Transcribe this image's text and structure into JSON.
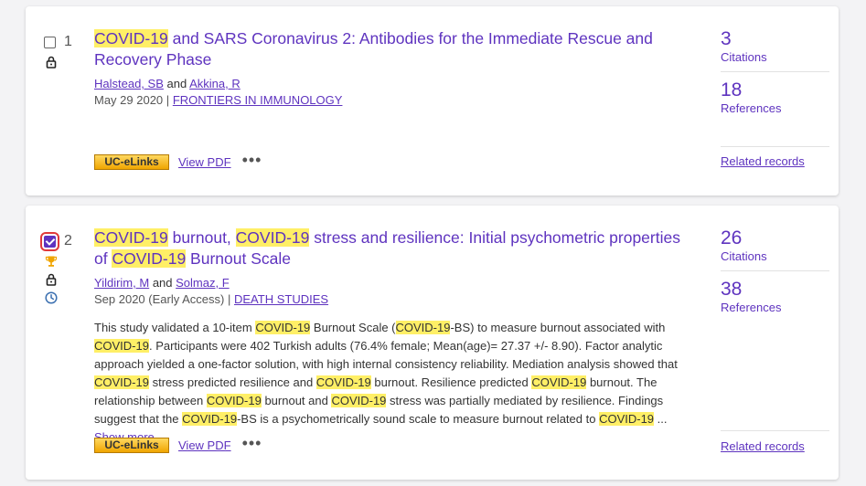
{
  "records": [
    {
      "number": "1",
      "checked": false,
      "title_parts": [
        {
          "text": "COVID-19",
          "hl": true
        },
        {
          "text": " and SARS Coronavirus 2: Antibodies for the Immediate Rescue and Recovery Phase",
          "hl": false
        }
      ],
      "author1": "Halstead, SB",
      "author_and": "and",
      "author2": "Akkina, R",
      "date": "May 29 2020",
      "sep": "|",
      "journal": "FRONTIERS IN IMMUNOLOGY",
      "citations_count": "3",
      "citations_label": "Citations",
      "references_count": "18",
      "references_label": "References",
      "related_label": "Related records",
      "ucelinks_label": "UC-eLinks",
      "viewpdf_label": "View PDF",
      "more_actions_label": "•••"
    },
    {
      "number": "2",
      "checked": true,
      "title_parts": [
        {
          "text": "COVID-19",
          "hl": true
        },
        {
          "text": " burnout, ",
          "hl": false
        },
        {
          "text": "COVID-19",
          "hl": true
        },
        {
          "text": " stress and resilience: Initial psychometric properties of ",
          "hl": false
        },
        {
          "text": "COVID-19",
          "hl": true
        },
        {
          "text": " Burnout Scale",
          "hl": false
        }
      ],
      "author1": "Yildirim, M",
      "author_and": "and",
      "author2": "Solmaz, F",
      "date": "Sep 2020 (Early Access)",
      "sep": "|",
      "journal": "DEATH STUDIES",
      "abstract_parts": [
        {
          "text": "This study validated a 10-item ",
          "hl": false
        },
        {
          "text": "COVID-19",
          "hl": true
        },
        {
          "text": " Burnout Scale (",
          "hl": false
        },
        {
          "text": "COVID-19",
          "hl": true
        },
        {
          "text": "-BS) to measure burnout associated with ",
          "hl": false
        },
        {
          "text": "COVID-19",
          "hl": true
        },
        {
          "text": ". Participants were 402 Turkish adults (76.4% female; Mean(age)= 27.37 +/- 8.90). Factor analytic approach yielded a one-factor solution, with high internal consistency reliability. Mediation analysis showed that ",
          "hl": false
        },
        {
          "text": "COVID-19",
          "hl": true
        },
        {
          "text": " stress predicted resilience and ",
          "hl": false
        },
        {
          "text": "COVID-19",
          "hl": true
        },
        {
          "text": " burnout. Resilience predicted ",
          "hl": false
        },
        {
          "text": "COVID-19",
          "hl": true
        },
        {
          "text": " burnout. The relationship between ",
          "hl": false
        },
        {
          "text": "COVID-19",
          "hl": true
        },
        {
          "text": " burnout and ",
          "hl": false
        },
        {
          "text": "COVID-19",
          "hl": true
        },
        {
          "text": " stress was partially mediated by resilience. Findings suggest that the ",
          "hl": false
        },
        {
          "text": "COVID-19",
          "hl": true
        },
        {
          "text": "-BS is a psychometrically sound scale to measure burnout related to ",
          "hl": false
        },
        {
          "text": "COVID-19",
          "hl": true
        },
        {
          "text": " ...",
          "hl": false
        }
      ],
      "show_more_label": "Show more",
      "citations_count": "26",
      "citations_label": "Citations",
      "references_count": "38",
      "references_label": "References",
      "related_label": "Related records",
      "ucelinks_label": "UC-eLinks",
      "viewpdf_label": "View PDF",
      "more_actions_label": "•••"
    }
  ],
  "colors": {
    "accent": "#5e33bf",
    "highlight": "#ffef66",
    "checkbox_focus": "#e03a3a",
    "uc_elinks_bg": "#f0a500"
  },
  "icons": [
    "lock-icon",
    "trophy-icon",
    "clock-icon",
    "more-options-icon"
  ]
}
